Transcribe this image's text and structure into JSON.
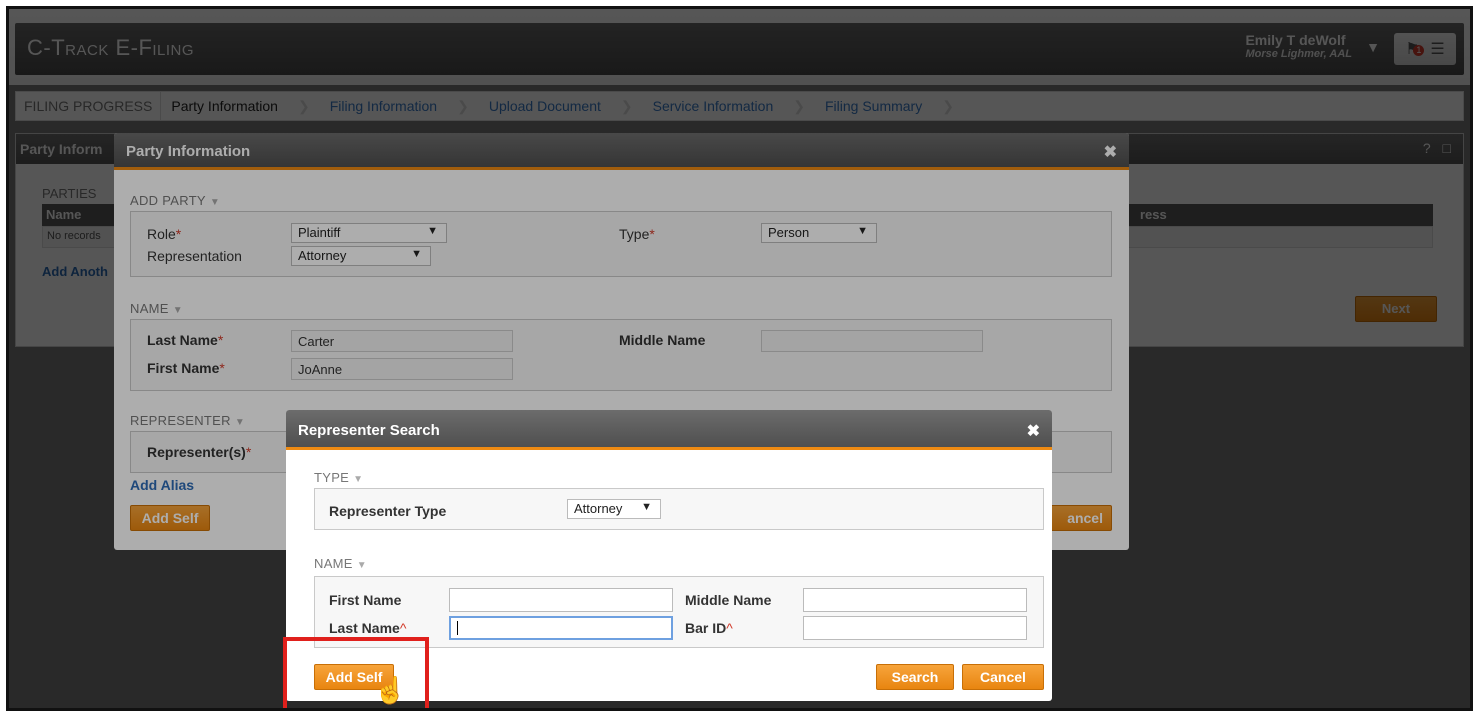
{
  "app": {
    "title": "C-Track E-Filing",
    "user_name": "Emily T deWolf",
    "user_org": "Morse Lighmer, AAL",
    "icons": [
      "caret-down-icon",
      "notification-icon",
      "cart-icon"
    ],
    "notification_count": "1"
  },
  "progress": {
    "label": "FILING PROGRESS",
    "steps": [
      "Party Information",
      "Filing Information",
      "Upload Document",
      "Service Information",
      "Filing Summary"
    ]
  },
  "page": {
    "panel_title": "Party Inform",
    "parties_label": "PARTIES",
    "table_header_name": "Name",
    "table_header_address": "ress",
    "no_records": "No records",
    "add_another": "Add Anoth",
    "next": "Next",
    "panel_tools": "?"
  },
  "party_modal": {
    "title": "Party Information",
    "add_party": "ADD PARTY",
    "role_label": "Role",
    "role_value": "Plaintiff",
    "type_label": "Type",
    "type_value": "Person",
    "representation_label": "Representation",
    "representation_value": "Attorney",
    "name_section": "NAME",
    "last_name_label": "Last Name",
    "last_name_value": "Carter",
    "first_name_label": "First Name",
    "first_name_value": "JoAnne",
    "middle_name_label": "Middle Name",
    "middle_name_value": "",
    "representer_section": "REPRESENTER",
    "representers_label": "Representer(s)",
    "add_alias": "Add Alias",
    "add_self": "Add Self",
    "cancel_partial": "ancel"
  },
  "rep_modal": {
    "title": "Representer Search",
    "type_section": "TYPE",
    "rep_type_label": "Representer Type",
    "rep_type_value": "Attorney",
    "name_section": "NAME",
    "first_name_label": "First Name",
    "middle_name_label": "Middle Name",
    "last_name_label": "Last Name",
    "bar_id_label": "Bar ID",
    "add_self": "Add Self",
    "search": "Search",
    "cancel": "Cancel"
  },
  "colors": {
    "accent": "#ee8a12",
    "header_gray": "#565656",
    "link": "#2d6bb5",
    "required": "#d23a2a",
    "highlight": "#e0201c"
  }
}
